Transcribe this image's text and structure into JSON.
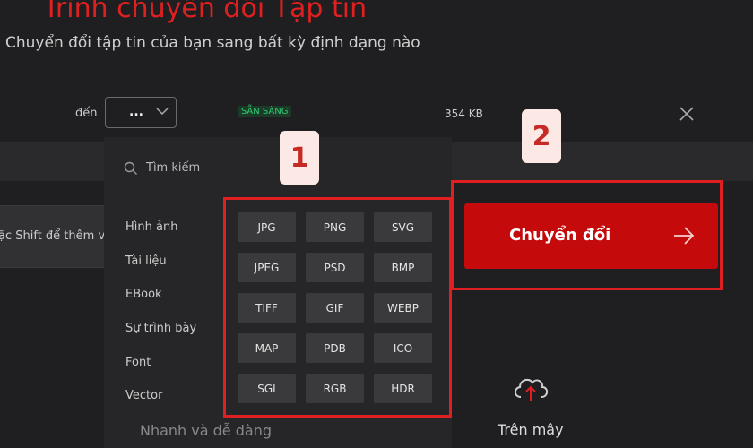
{
  "header": {
    "title": "Trình chuyển đổi Tập tin",
    "subtitle": "Chuyển đổi tập tin của bạn sang bất kỳ định dạng nào"
  },
  "file_row": {
    "to_label": "đến",
    "select_value": "...",
    "status_badge": "SẴN SÀNG",
    "file_size": "354 KB"
  },
  "drop_hint": "ặc Shift để thêm vài",
  "dropdown": {
    "search_placeholder": "Tìm kiếm",
    "categories": [
      "Hình ảnh",
      "Tài liệu",
      "EBook",
      "Sự trình bày",
      "Font",
      "Vector"
    ],
    "formats": [
      "JPG",
      "PNG",
      "SVG",
      "JPEG",
      "PSD",
      "BMP",
      "TIFF",
      "GIF",
      "WEBP",
      "MAP",
      "PDB",
      "ICO",
      "SGI",
      "RGB",
      "HDR"
    ]
  },
  "annotations": {
    "marker_1": "1",
    "marker_2": "2"
  },
  "convert_button": {
    "label": "Chuyển đổi"
  },
  "footer": {
    "partial_label": "Nhanh và dễ dàng",
    "cloud_label": "Trên mây"
  },
  "colors": {
    "accent": "#c40a0a",
    "highlight_box": "#e02020",
    "background": "#1f1f21",
    "badge": "#2ecc71"
  }
}
